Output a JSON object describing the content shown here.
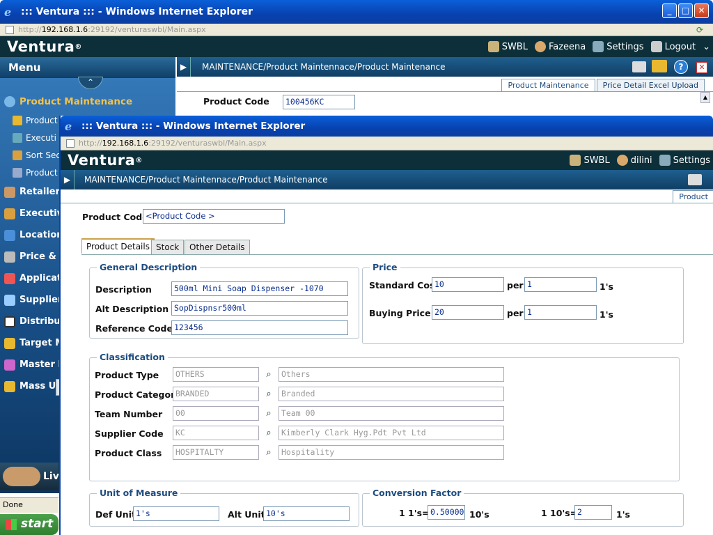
{
  "back_window": {
    "title": "::: Ventura ::: - Windows Internet Explorer",
    "url_prefix": "http://",
    "url_host": "192.168.1.6",
    "url_rest": ":29192/venturaswbl/Main.aspx",
    "brand": "Ventura",
    "brand_mark": "®",
    "user_items": [
      "SWBL",
      "Fazeena",
      "Settings",
      "Logout"
    ],
    "breadcrumb": "MAINTENANCE/Product Maintennace/Product Maintenance",
    "tabs": [
      "Product Maintenance",
      "Price Detail Excel Upload"
    ],
    "product_code_label": "Product Code",
    "product_code_value": "100456KC",
    "status": "Done"
  },
  "menu": {
    "title": "Menu",
    "active_item": "Product Maintenance",
    "sub_items": [
      "Product",
      "Executi",
      "Sort Sec",
      "Product"
    ],
    "items": [
      "Retailer",
      "Executiv",
      "Location",
      "Price & D",
      "Applicati",
      "Supplier",
      "Distribut",
      "Target M",
      "Master R",
      "Mass Upd"
    ],
    "live_label": "Liv"
  },
  "front_window": {
    "title": "::: Ventura ::: - Windows Internet Explorer",
    "url_prefix": "http://",
    "url_host": "192.168.1.6",
    "url_rest": ":29192/venturaswbl/Main.aspx",
    "brand": "Ventura",
    "brand_mark": "®",
    "user_items": [
      "SWBL",
      "dilini",
      "Settings"
    ],
    "breadcrumb": "MAINTENANCE/Product Maintennace/Product Maintenance",
    "tab_partial": "Product"
  },
  "form": {
    "product_code_label": "Product Code",
    "product_code_placeholder": "<Product Code >",
    "tabs": [
      "Product Details",
      "Stock",
      "Other Details"
    ],
    "general": {
      "legend": "General Description",
      "description_label": "Description",
      "description": "500ml Mini Soap Dispenser -1070",
      "alt_label": "Alt Description",
      "alt": "SopDispnsr500ml",
      "ref_label": "Reference Code",
      "ref": "123456"
    },
    "price": {
      "legend": "Price",
      "std_label": "Standard Cost",
      "std_value": "10",
      "std_per": "1",
      "buy_label": "Buying Price",
      "buy_value": "20",
      "buy_per": "1",
      "per_label": "per",
      "unit_label": "1's"
    },
    "classification": {
      "legend": "Classification",
      "rows": [
        {
          "label": "Product Type",
          "code": "OTHERS",
          "name": "Others"
        },
        {
          "label": "Product Category",
          "code": "BRANDED",
          "name": "Branded"
        },
        {
          "label": "Team Number",
          "code": "00",
          "name": "Team 00"
        },
        {
          "label": "Supplier Code",
          "code": "KC",
          "name": "Kimberly Clark Hyg.Pdt Pvt Ltd"
        },
        {
          "label": "Product Class",
          "code": "HOSPITALTY",
          "name": "Hospitality"
        }
      ]
    },
    "uom": {
      "legend": "Unit of Measure",
      "def_label": "Def Unit",
      "def_value": "1's",
      "alt_label": "Alt Unit",
      "alt_value": "10's"
    },
    "conversion": {
      "legend": "Conversion Factor",
      "a_label": "1 1's=",
      "a_value": "0.500000",
      "a_unit": "10's",
      "b_label": "1 10's=",
      "b_value": "2",
      "b_unit": "1's"
    }
  },
  "taskbar": {
    "start": "start"
  }
}
